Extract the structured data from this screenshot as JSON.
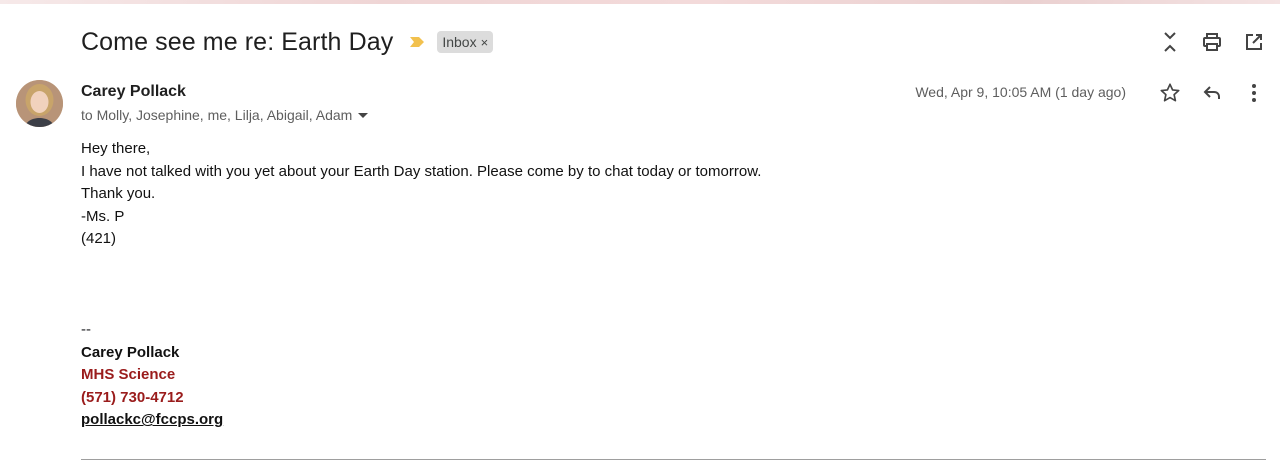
{
  "email": {
    "subject": "Come see me re: Earth Day",
    "label": "Inbox",
    "label_remove": "×",
    "sender": "Carey Pollack",
    "recipients": "to Molly, Josephine, me, Lilja, Abigail, Adam",
    "date": "Wed, Apr 9, 10:05 AM (1 day ago)",
    "body_lines": [
      "Hey there,",
      "I have not talked with you yet about your Earth Day station. Please come by to chat today or tomorrow.",
      "Thank you.",
      "-Ms. P",
      "(421)"
    ],
    "signature": {
      "separator": "--",
      "name": "Carey Pollack",
      "dept": "MHS Science",
      "phone": "(571) 730-4712",
      "email": "pollackc@fccps.org"
    }
  },
  "icons": {
    "importance": "importance-marker-icon",
    "collapse": "expand-collapse-icon",
    "print": "print-icon",
    "open_new": "open-in-new-window-icon",
    "star": "star-icon",
    "reply": "reply-icon",
    "more": "more-vert-icon"
  },
  "colors": {
    "importance": "#f2c14e",
    "signature_accent": "#9a1c1c"
  }
}
